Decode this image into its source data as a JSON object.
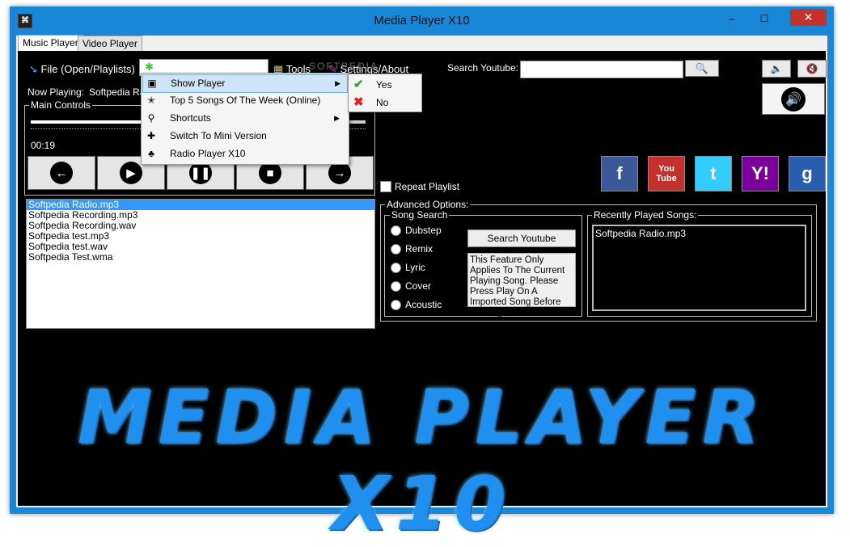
{
  "window": {
    "title": "Media Player X10",
    "min_label": "–",
    "max_label": "☐",
    "close_label": "✕"
  },
  "tabs": [
    {
      "label": "Music Player"
    },
    {
      "label": "Video Player"
    }
  ],
  "menubar": {
    "file": "File (Open/Playlists)",
    "tools": "Tools",
    "settings": "Settings/About",
    "search_label": "Search Youtube:",
    "search_value": ""
  },
  "now_playing": {
    "label": "Now Playing:",
    "value": "Softpedia Radio.mp3"
  },
  "main_controls": {
    "label": "Main Controls",
    "time": "00:19",
    "progress": 0.45
  },
  "playlist": {
    "items": [
      "Softpedia Radio.mp3",
      "Softpedia Recording.mp3",
      "Softpedia Recording.wav",
      "Softpedia test.mp3",
      "Softpedia test.wav",
      "Softpedia Test.wma"
    ],
    "selected_index": 0
  },
  "repeat": {
    "label": "Repeat Playlist",
    "checked": false
  },
  "advanced": {
    "label": "Advanced Options:",
    "song_search": {
      "label": "Song Search",
      "options": [
        "Dubstep",
        "Remix",
        "Lyric",
        "Cover",
        "Acoustic"
      ]
    },
    "search_button": "Search Youtube",
    "note": "This Feature Only Applies To The Current Playing Song. Please Press Play On A Imported Song Before Clicking Search.",
    "recent": {
      "label": "Recently Played Songs:",
      "items": [
        "Softpedia Radio.mp3"
      ]
    }
  },
  "dropdown": {
    "items": [
      {
        "label": "Show Player",
        "icon": "player-icon",
        "submenu": true
      },
      {
        "label": "Top 5 Songs Of The Week (Online)",
        "icon": "star-icon",
        "submenu": false
      },
      {
        "label": "Shortcuts",
        "icon": "key-icon",
        "submenu": true
      },
      {
        "label": "Switch To Mini Version",
        "icon": "puzzle-icon",
        "submenu": false
      },
      {
        "label": "Radio Player X10",
        "icon": "radio-icon",
        "submenu": false
      }
    ],
    "submenu": [
      {
        "label": "Yes",
        "icon": "check-icon"
      },
      {
        "label": "No",
        "icon": "x-icon"
      }
    ]
  },
  "social": [
    {
      "name": "facebook-icon",
      "label": "f",
      "color": "#3b5998"
    },
    {
      "name": "youtube-icon",
      "label": "You Tube",
      "color": "#c4302b"
    },
    {
      "name": "twitter-icon",
      "label": "t",
      "color": "#33ccff"
    },
    {
      "name": "yahoo-icon",
      "label": "Y!",
      "color": "#7b0099"
    },
    {
      "name": "google-icon",
      "label": "g",
      "color": "#2a5db0"
    }
  ],
  "logo_text": "MEDIA PLAYER X10",
  "watermark": "SOFTPEDIA"
}
